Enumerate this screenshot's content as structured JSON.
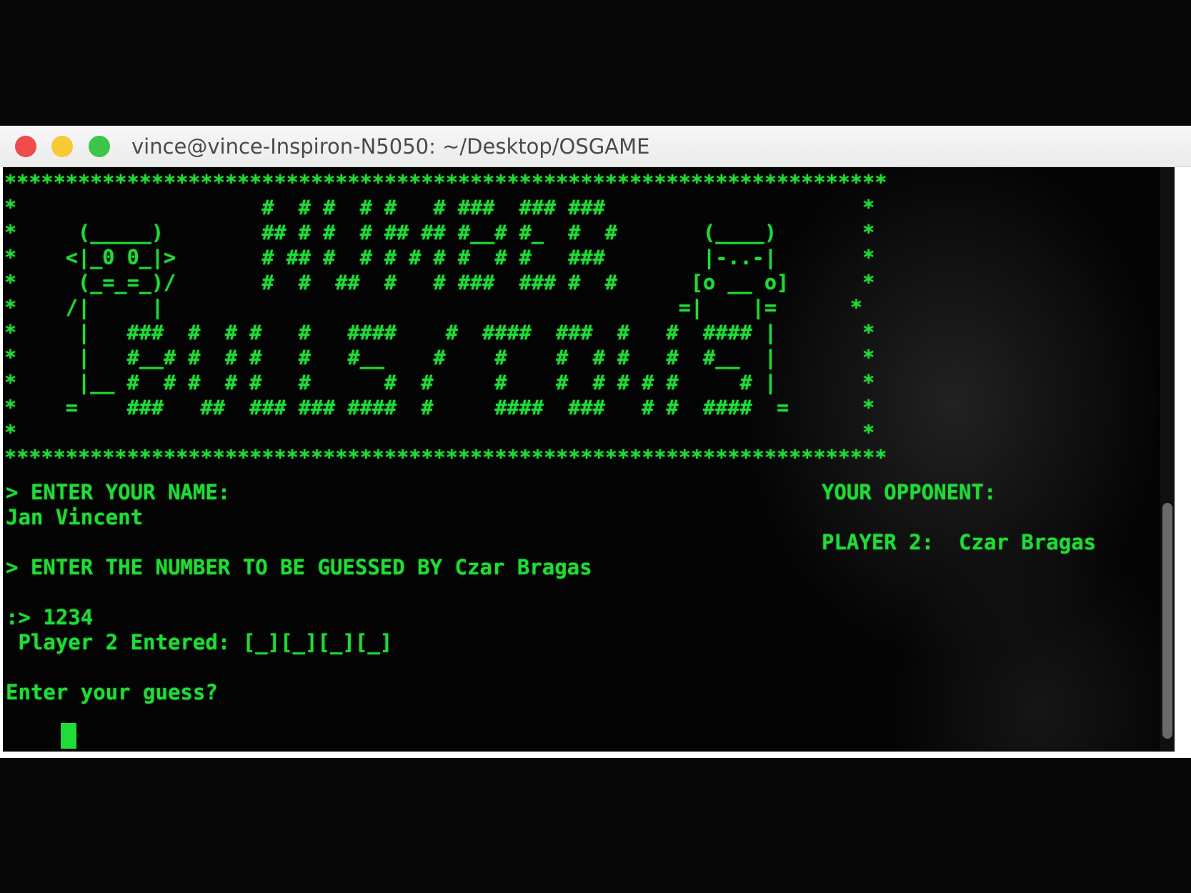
{
  "window": {
    "title": "vince@vince-Inspiron-N5050: ~/Desktop/OSGAME"
  },
  "banner": {
    "art": "************************************************************************\n*                    #  # #  # #   # ###  ### ###                     *\n*     (_____)        ## # #  # ## ## #__# #_  #  #       (____)       *\n*    <|_0 0_|>       # ## #  # # # # #  # #   ###        |-..-|       *\n*     (_=_=_)/       #  #  ##  #   # ###  ### #  #      [o __ o]      *\n*    /|     |                                          =|    |=      *\n*     |   ###  #  # #   #   ####    #  ####  ###  #   #  #### |       *\n*     |   #__# #  # #   #   #__    #    #    #  # #   #  #__  |       *\n*     |__ #  # #  # #   #      #  #     #    #  # # # #     # |       *\n*    =    ###   ##  ### ### ####  #     ####  ###   # #  ####  =      *\n*                                                                     *\n************************************************************************"
  },
  "prompts": {
    "enter_name": "> ENTER YOUR NAME:",
    "name_value": "Jan Vincent",
    "enter_number": "> ENTER THE NUMBER TO BE GUESSED BY Czar Bragas",
    "number_input": ":> 1234",
    "player2_entered": " Player 2 Entered: [_][_][_][_]",
    "guess_prompt": "Enter your guess?"
  },
  "opponent": {
    "heading": "YOUR OPPONENT:",
    "player_line": "PLAYER 2:  Czar Bragas"
  },
  "colors": {
    "terminal_text": "#20dc36",
    "terminal_bg": "#040404",
    "close": "#ee4b4b",
    "minimize": "#f7c935",
    "maximize": "#3dc44a"
  }
}
